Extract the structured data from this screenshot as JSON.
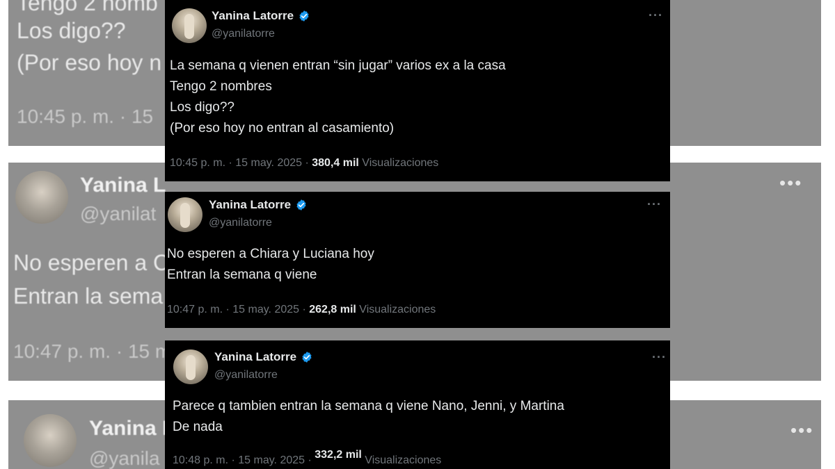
{
  "background": {
    "card1": {
      "lines": [
        "Tengo 2 nomb",
        "Los digo??",
        "(Por eso hoy n"
      ],
      "meta": "10:45 p. m. · 15"
    },
    "card2": {
      "name": "Yanina L",
      "handle": "@yanilat",
      "lines": [
        "No esperen a C",
        "Entran la sema"
      ],
      "meta": "10:47 p. m. · 15 m"
    },
    "card3": {
      "name": "Yanina L",
      "handle": "@yanila"
    }
  },
  "tweets": [
    {
      "name": "Yanina Latorre",
      "handle": "@yanilatorre",
      "text": "La semana q vienen entran “sin jugar” varios ex a la casa\nTengo 2 nombres\nLos digo??\n(Por eso hoy no entran al casamiento)",
      "time": "10:45 p. m. · 15 may. 2025 · ",
      "views": "380,4 mil",
      "views_label": " Visualizaciones"
    },
    {
      "name": "Yanina Latorre",
      "handle": "@yanilatorre",
      "text": "No esperen a Chiara y Luciana hoy\nEntran la semana q viene",
      "time": "10:47 p. m. · 15 may. 2025 · ",
      "views": "262,8 mil",
      "views_label": " Visualizaciones"
    },
    {
      "name": "Yanina Latorre",
      "handle": "@yanilatorre",
      "text": "Parece q tambien entran la semana q viene Nano, Jenni, y Martina\nDe nada",
      "time": "10:48 p. m. · 15 may. 2025 · ",
      "views": "332,2 mil",
      "views_label": " Visualizaciones"
    }
  ],
  "icons": {
    "verified": "verified-badge-icon",
    "more": "more-options-icon"
  },
  "colors": {
    "verified": "#1d9bf0",
    "muted": "#71767b",
    "text": "#e7e9ea"
  }
}
